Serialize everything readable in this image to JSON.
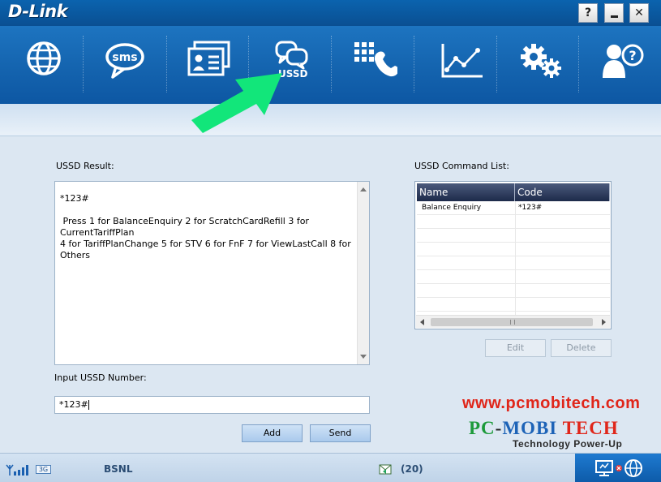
{
  "app": {
    "logo": "D-Link",
    "window_buttons": {
      "help": "?",
      "minimize": "_",
      "close": "✕"
    }
  },
  "toolbar": {
    "items": [
      {
        "id": "internet",
        "icon": "globe-icon"
      },
      {
        "id": "sms",
        "icon": "sms-bubble-icon",
        "label": "sms"
      },
      {
        "id": "contacts",
        "icon": "contact-cards-icon"
      },
      {
        "id": "ussd",
        "icon": "ussd-chat-icon",
        "label": "USSD",
        "active": true
      },
      {
        "id": "call",
        "icon": "dialpad-phone-icon"
      },
      {
        "id": "statistics",
        "icon": "line-chart-icon"
      },
      {
        "id": "settings",
        "icon": "gears-icon"
      },
      {
        "id": "help",
        "icon": "user-help-icon"
      }
    ]
  },
  "ussd": {
    "result_label": "USSD Result:",
    "result_text": "*123#\n\n Press 1 for BalanceEnquiry 2 for ScratchCardRefill 3 for CurrentTariffPlan\n4 for TariffPlanChange 5 for STV 6 for FnF 7 for ViewLastCall 8 for Others",
    "input_label": "Input USSD Number:",
    "input_value": "*123#",
    "add_label": "Add",
    "send_label": "Send"
  },
  "command_list": {
    "label": "USSD Command List:",
    "columns": [
      "Name",
      "Code"
    ],
    "rows": [
      {
        "name": "Balance Enquiry",
        "code": "*123#"
      }
    ],
    "edit_label": "Edit",
    "delete_label": "Delete"
  },
  "watermark": {
    "url": "www.pcmobitech.com",
    "name_parts": [
      "PC",
      "-",
      "MOBI",
      "TECH"
    ],
    "tagline": "Technology Power-Up"
  },
  "status": {
    "network_type": "3G",
    "operator": "BSNL",
    "message_count": "(20)"
  },
  "colors": {
    "toolbar_blue": "#1565b0",
    "arrow_green": "#12e67a",
    "watermark_red": "#e0261a"
  }
}
